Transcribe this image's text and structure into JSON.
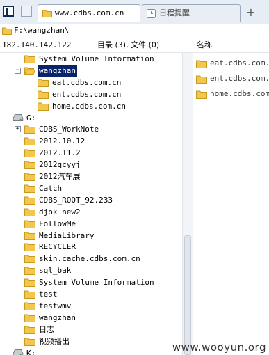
{
  "tabs": [
    {
      "label": "www.cdbs.com.cn",
      "active": true
    },
    {
      "label": "日程提醒",
      "active": false
    }
  ],
  "address": "F:\\wangzhan\\",
  "header": {
    "ip": "182.140.142.122",
    "count": "目录 (3), 文件 (0)",
    "name_col": "名称"
  },
  "tree": [
    {
      "label": "System Volume Information",
      "indent": 1
    },
    {
      "label": "wangzhan",
      "indent": 1,
      "expanded": true,
      "selected": true
    },
    {
      "label": "eat.cdbs.com.cn",
      "indent": 2
    },
    {
      "label": "ent.cdbs.com.cn",
      "indent": 2
    },
    {
      "label": "home.cdbs.com.cn",
      "indent": 2
    },
    {
      "label": "G:",
      "indent": 0,
      "drive": true
    },
    {
      "label": "CDBS_WorkNote",
      "indent": 1,
      "expandable": true
    },
    {
      "label": "2012.10.12",
      "indent": 1
    },
    {
      "label": "2012.11.2",
      "indent": 1
    },
    {
      "label": "2012qcyyj",
      "indent": 1
    },
    {
      "label": "2012汽车展",
      "indent": 1
    },
    {
      "label": "Catch",
      "indent": 1
    },
    {
      "label": "CDBS_ROOT_92.233",
      "indent": 1
    },
    {
      "label": "djok_new2",
      "indent": 1
    },
    {
      "label": "FollowMe",
      "indent": 1
    },
    {
      "label": "MediaLibrary",
      "indent": 1
    },
    {
      "label": "RECYCLER",
      "indent": 1
    },
    {
      "label": "skin.cache.cdbs.com.cn",
      "indent": 1
    },
    {
      "label": "sql_bak",
      "indent": 1
    },
    {
      "label": "System Volume Information",
      "indent": 1
    },
    {
      "label": "test",
      "indent": 1
    },
    {
      "label": "testwmv",
      "indent": 1
    },
    {
      "label": "wangzhan",
      "indent": 1
    },
    {
      "label": "日志",
      "indent": 1
    },
    {
      "label": "视频播出",
      "indent": 1
    },
    {
      "label": "K:",
      "indent": 0,
      "drive": true
    }
  ],
  "files": [
    {
      "label": "eat.cdbs.com.cn"
    },
    {
      "label": "ent.cdbs.com.cn"
    },
    {
      "label": "home.cdbs.com.cn"
    }
  ],
  "watermark": "www.wooyun.org",
  "colors": {
    "folder": "#f3c64d",
    "folder_edge": "#c99a1e",
    "selection": "#0a246a"
  }
}
